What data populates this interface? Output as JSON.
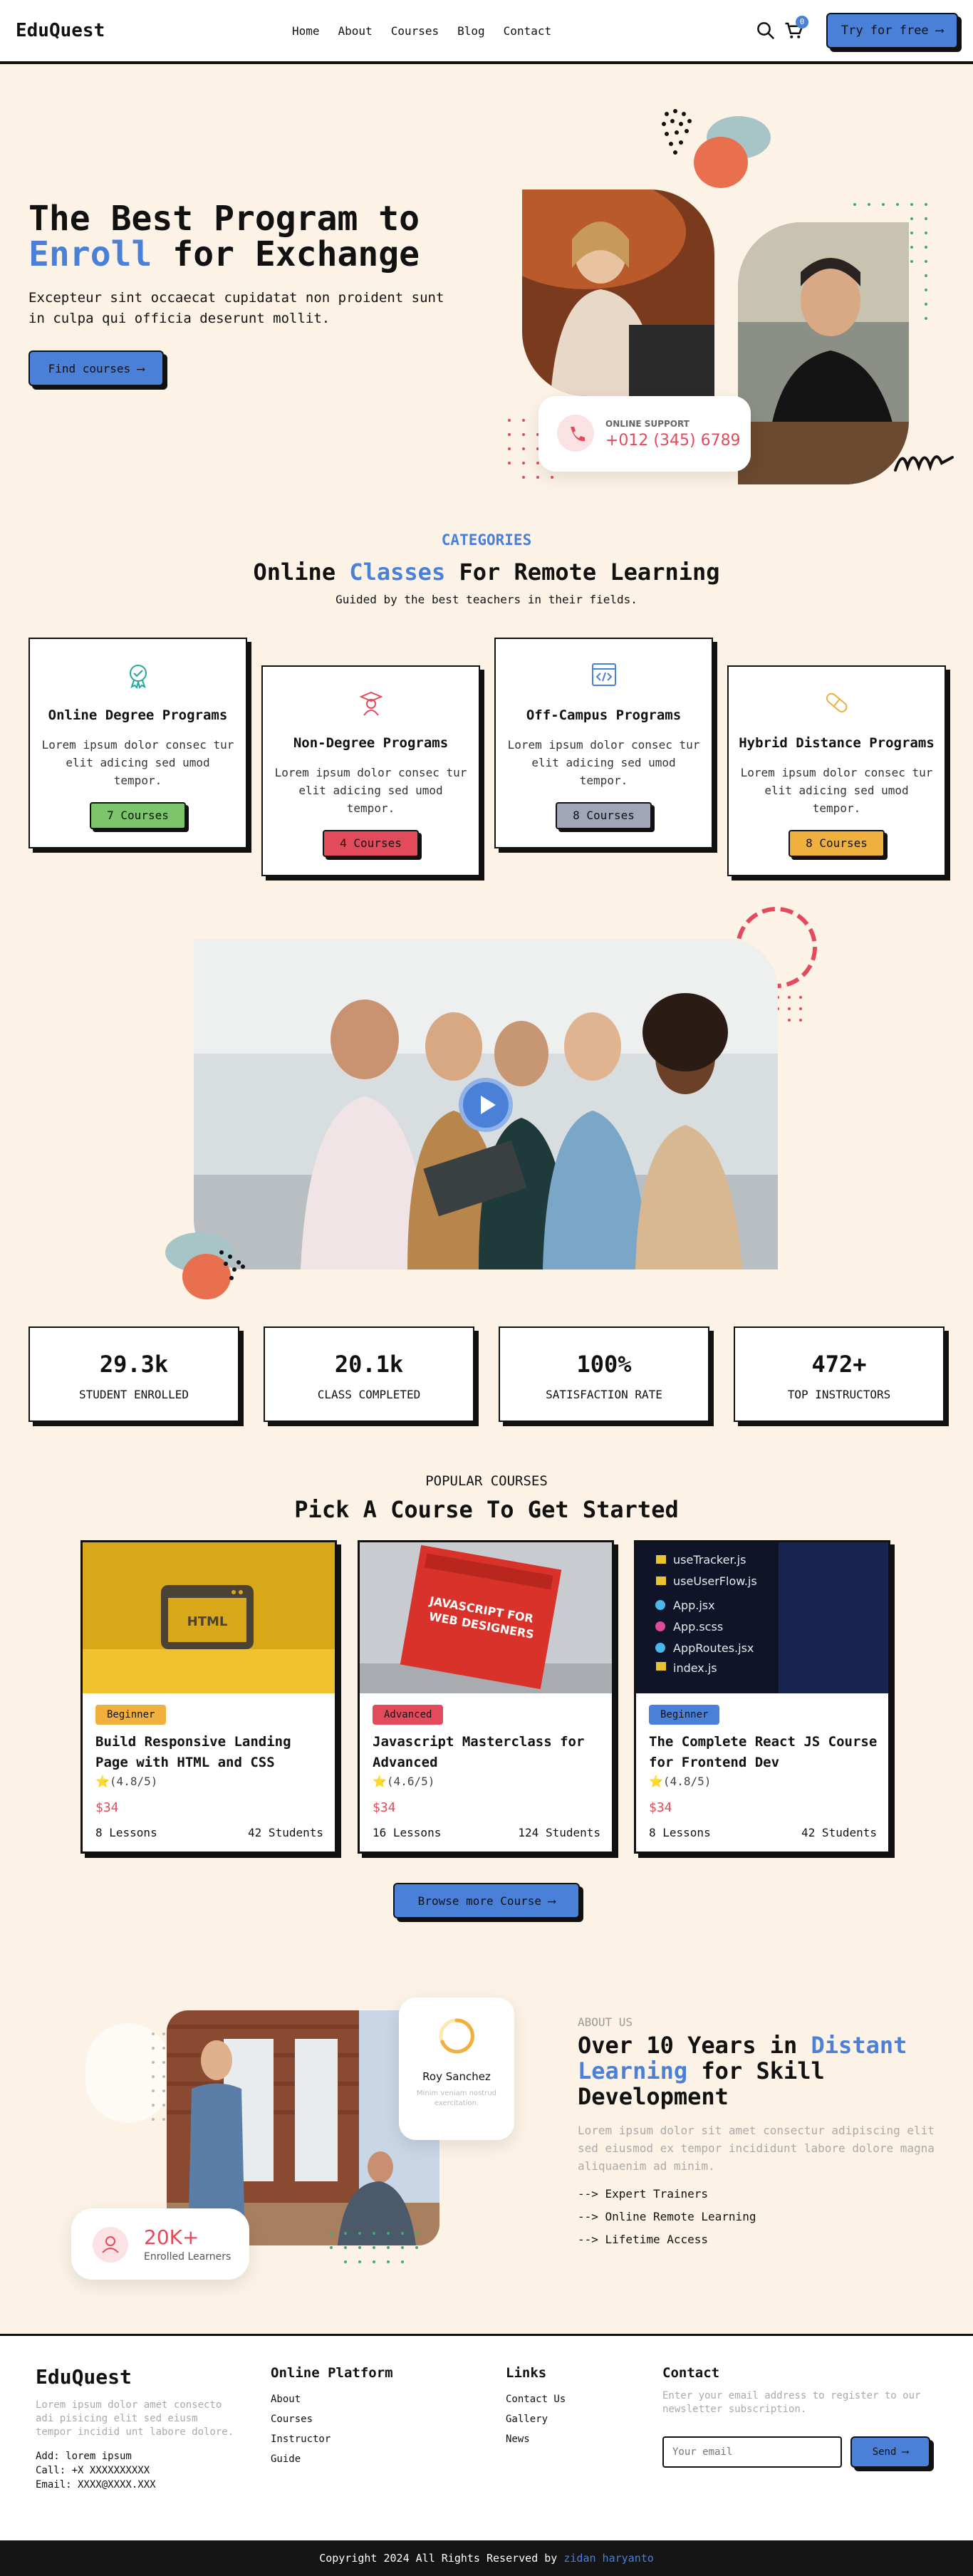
{
  "header": {
    "logo": "EduQuest",
    "nav": [
      "Home",
      "About",
      "Courses",
      "Blog",
      "Contact"
    ],
    "cart_count": "0",
    "cta": "Try for free ⟶"
  },
  "hero": {
    "title_line1": "The Best Program to",
    "title_highlight": "Enroll",
    "title_rest": " for Exchange",
    "subtitle": "Excepteur sint occaecat cupidatat non proident sunt in culpa qui officia deserunt mollit.",
    "button": "Find courses ⟶",
    "support_label": "ONLINE SUPPORT",
    "support_phone": "+012 (345) 6789"
  },
  "categories": {
    "eyebrow": "CATEGORIES",
    "title_a": "Online ",
    "title_highlight": "Classes",
    "title_b": " For Remote Learning",
    "subtitle": "Guided by the best teachers in their fields.",
    "items": [
      {
        "title": "Online Degree Programs",
        "desc": "Lorem ipsum dolor consec tur elit adicing sed umod tempor.",
        "count": "7 Courses",
        "color": "#7cc56b",
        "icon": "graduation-icon"
      },
      {
        "title": "Non-Degree Programs",
        "desc": "Lorem ipsum dolor consec tur elit adicing sed umod tempor.",
        "count": "4 Courses",
        "color": "#e34b5c",
        "icon": "scholar-icon"
      },
      {
        "title": "Off-Campus Programs",
        "desc": "Lorem ipsum dolor consec tur elit adicing sed umod tempor.",
        "count": "8 Courses",
        "color": "#a0a5b8",
        "icon": "code-icon"
      },
      {
        "title": "Hybrid Distance Programs",
        "desc": "Lorem ipsum dolor consec tur elit adicing sed umod tempor.",
        "count": "8 Courses",
        "color": "#f0b03e",
        "icon": "pill-icon"
      }
    ]
  },
  "stats": [
    {
      "value": "29.3k",
      "label": "STUDENT ENROLLED"
    },
    {
      "value": "20.1k",
      "label": "CLASS COMPLETED"
    },
    {
      "value": "100%",
      "label": "SATISFACTION RATE"
    },
    {
      "value": "472+",
      "label": "TOP INSTRUCTORS"
    }
  ],
  "courses": {
    "eyebrow": "POPULAR COURSES",
    "title": "Pick A Course To Get Started",
    "browse": "Browse more Course ⟶",
    "items": [
      {
        "level": "Beginner",
        "level_color": "#f0b03e",
        "name": "Build Responsive Landing Page with HTML and CSS",
        "rating": "(4.8/5)",
        "price": "$34",
        "lessons": "8 Lessons",
        "students": "42 Students"
      },
      {
        "level": "Advanced",
        "level_color": "#e34b5c",
        "name": "Javascript Masterclass for Advanced",
        "rating": "(4.6/5)",
        "price": "$34",
        "lessons": "16 Lessons",
        "students": "124 Students"
      },
      {
        "level": "Beginner",
        "level_color": "#4a80d8",
        "name": "The Complete React JS Course for Frontend Dev",
        "rating": "(4.8/5)",
        "price": "$34",
        "lessons": "8 Lessons",
        "students": "42 Students"
      }
    ]
  },
  "about": {
    "eyebrow": "ABOUT US",
    "title_a": "Over 10 Years in ",
    "title_highlight": "Distant Learning",
    "title_b": " for Skill Development",
    "desc": "Lorem ipsum dolor sit amet consectur adipiscing elit sed eiusmod ex tempor incididunt labore dolore magna aliquaenim ad minim.",
    "list": [
      "--> Expert Trainers",
      "--> Online Remote Learning",
      "--> Lifetime Access"
    ],
    "tutor_name": "Roy Sanchez",
    "tutor_sub": "Minim veniam nostrud exercitation.",
    "enrolled_value": "20K+",
    "enrolled_label": "Enrolled Learners"
  },
  "footer": {
    "logo": "EduQuest",
    "desc": "Lorem ipsum dolor amet consecto adi pisicing elit sed eiusm tempor incidid unt labore dolore.",
    "address": "Add: lorem ipsum",
    "call": "Call: +X XXXXXXXXXX",
    "email": "Email: XXXX@XXXX.XXX",
    "col1_title": "Online Platform",
    "col1": [
      "About",
      "Courses",
      "Instructor",
      "Guide"
    ],
    "col2_title": "Links",
    "col2": [
      "Contact Us",
      "Gallery",
      "News"
    ],
    "col3_title": "Contact",
    "col3_desc": "Enter your email address to register to our newsletter subscription.",
    "email_placeholder": "Your email",
    "send": "Send ⟶",
    "copyright": "Copyright 2024 All Rights Reserved by ",
    "author": "zidan haryanto"
  }
}
